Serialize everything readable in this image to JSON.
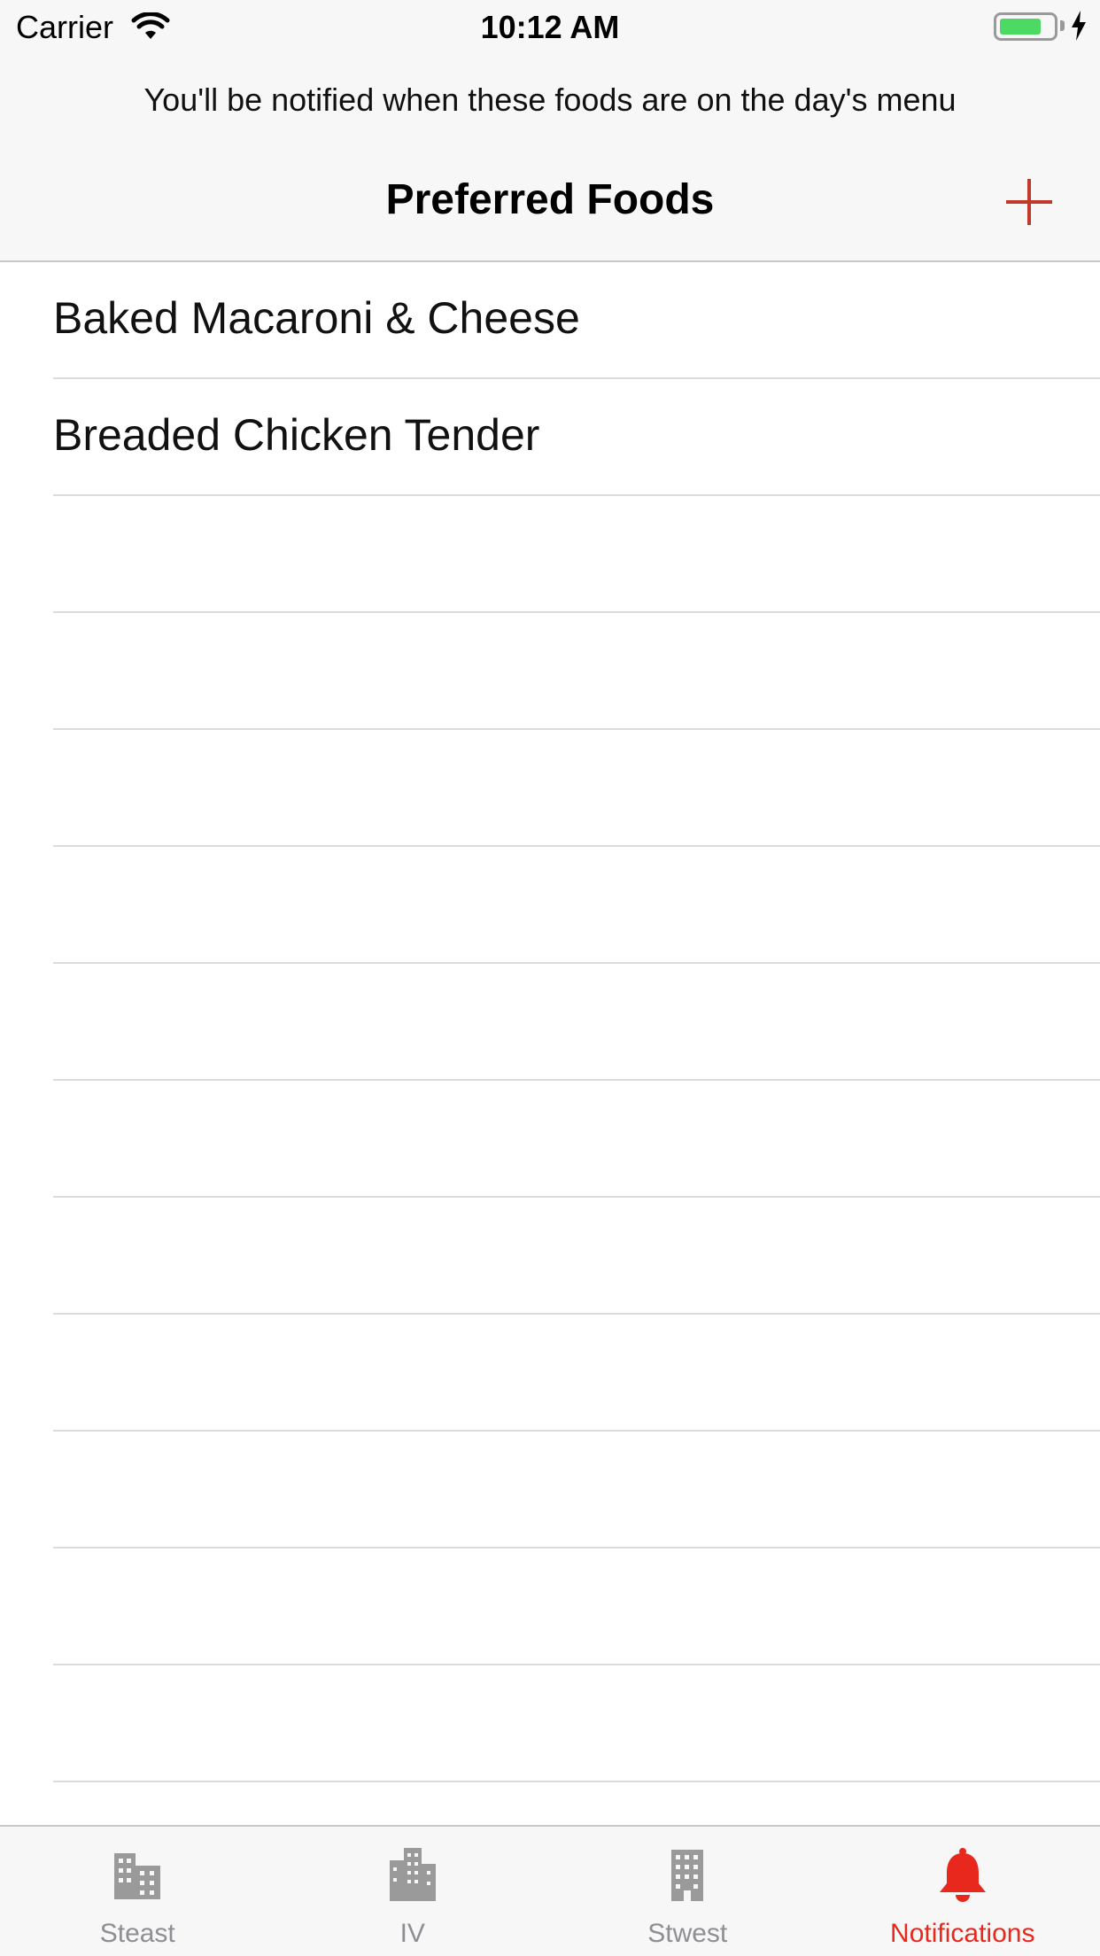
{
  "status_bar": {
    "carrier": "Carrier",
    "time": "10:12 AM",
    "battery_level": 0.8,
    "battery_color": "#4cd964"
  },
  "header": {
    "notice": "You'll be notified when these foods are on the day's menu",
    "title": "Preferred Foods",
    "add_icon": "plus-icon",
    "accent_color": "#c0392b"
  },
  "foods": [
    "Baked Macaroni & Cheese",
    "Breaded Chicken Tender",
    "",
    "",
    "",
    "",
    "",
    "",
    "",
    "",
    "",
    "",
    "",
    ""
  ],
  "tabs": [
    {
      "label": "Steast",
      "icon": "building-icon",
      "active": false
    },
    {
      "label": "IV",
      "icon": "highrise-icon",
      "active": false
    },
    {
      "label": "Stwest",
      "icon": "office-building-icon",
      "active": false
    },
    {
      "label": "Notifications",
      "icon": "bell-icon",
      "active": true
    }
  ],
  "colors": {
    "active_tab": "#e8271d",
    "inactive_tab": "#8e8e93"
  }
}
